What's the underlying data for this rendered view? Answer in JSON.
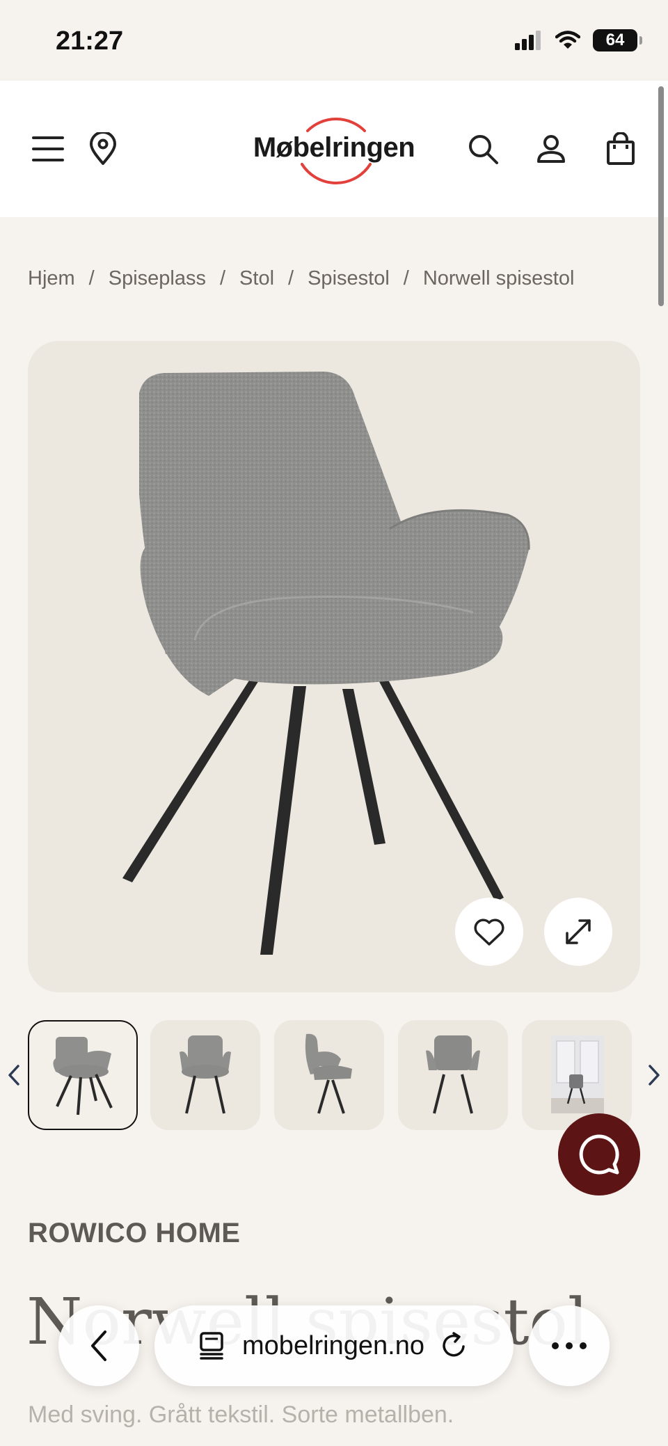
{
  "status_bar": {
    "time": "21:27",
    "battery": "64"
  },
  "header": {
    "logo_text": "Møbelringen"
  },
  "breadcrumb": [
    "Hjem",
    "Spiseplass",
    "Stol",
    "Spisestol",
    "Norwell spisestol"
  ],
  "product": {
    "brand": "ROWICO HOME",
    "title": "Norwell spisestol",
    "subtitle": "Med sving. Grått tekstil. Sorte metallben."
  },
  "browser": {
    "url": "mobelringen.no"
  },
  "colors": {
    "background": "#f6f2ee",
    "image_bg": "#ece7df",
    "logo_ring": "#e2413b",
    "chat_button": "#5c1414",
    "chair_fabric": "#8e8e8c",
    "chair_legs": "#2a2a2a"
  },
  "icons": [
    "menu-icon",
    "location-pin-icon",
    "search-icon",
    "account-icon",
    "shopping-bag-icon",
    "heart-icon",
    "expand-icon",
    "chevron-left-icon",
    "chevron-right-icon",
    "chat-icon",
    "back-icon",
    "tabs-icon",
    "reload-icon",
    "more-icon"
  ]
}
